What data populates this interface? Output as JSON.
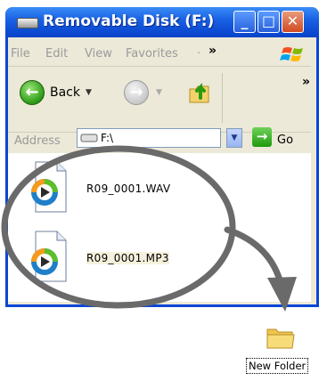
{
  "window": {
    "title": "Removable Disk (F:)",
    "controls": {
      "minimize": "_",
      "maximize": "□",
      "close": "✕"
    }
  },
  "menu": {
    "items": [
      "File",
      "Edit",
      "View",
      "Favorites"
    ],
    "overflow": "»"
  },
  "toolbar": {
    "back_label": "Back",
    "overflow": "»"
  },
  "address": {
    "label": "Address",
    "value": "F:\\",
    "go_label": "Go"
  },
  "files": [
    {
      "name": "R09_0001.WAV",
      "icon": "windows-media-player-icon"
    },
    {
      "name": "R09_0001.MP3",
      "icon": "windows-media-player-icon"
    }
  ],
  "desktop": {
    "folder_label": "New Folder",
    "folder_icon": "folder-icon"
  },
  "annotation": {
    "highlight": "ellipse-around-files",
    "arrow": "curved-arrow-to-folder"
  },
  "colors": {
    "titlebar": "#0a46d6",
    "annotation_stroke": "#6a6a6a",
    "window_face": "#ece9d8"
  }
}
